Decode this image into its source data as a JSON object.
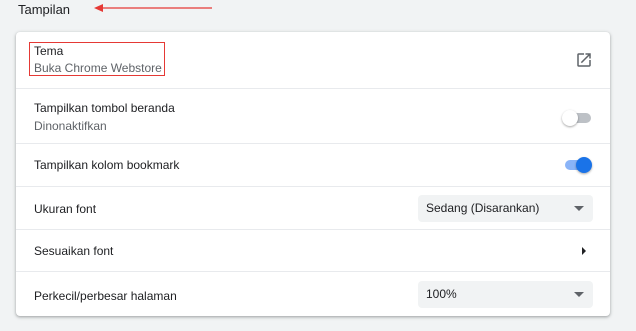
{
  "section": {
    "title": "Tampilan"
  },
  "settings": {
    "theme": {
      "label": "Tema",
      "sublabel": "Buka Chrome Webstore",
      "icon": "open-in-new-icon"
    },
    "home_button": {
      "label": "Tampilkan tombol beranda",
      "sublabel": "Dinonaktifkan",
      "enabled": false
    },
    "bookmarks_bar": {
      "label": "Tampilkan kolom bookmark",
      "enabled": true
    },
    "font_size": {
      "label": "Ukuran font",
      "selected": "Sedang (Disarankan)"
    },
    "customize_fonts": {
      "label": "Sesuaikan font"
    },
    "page_zoom": {
      "label": "Perkecil/perbesar halaman",
      "selected": "100%"
    }
  },
  "colors": {
    "accent": "#1a73e8",
    "toggle_on_track": "#8ab4f8",
    "annotation": "#e53935"
  }
}
